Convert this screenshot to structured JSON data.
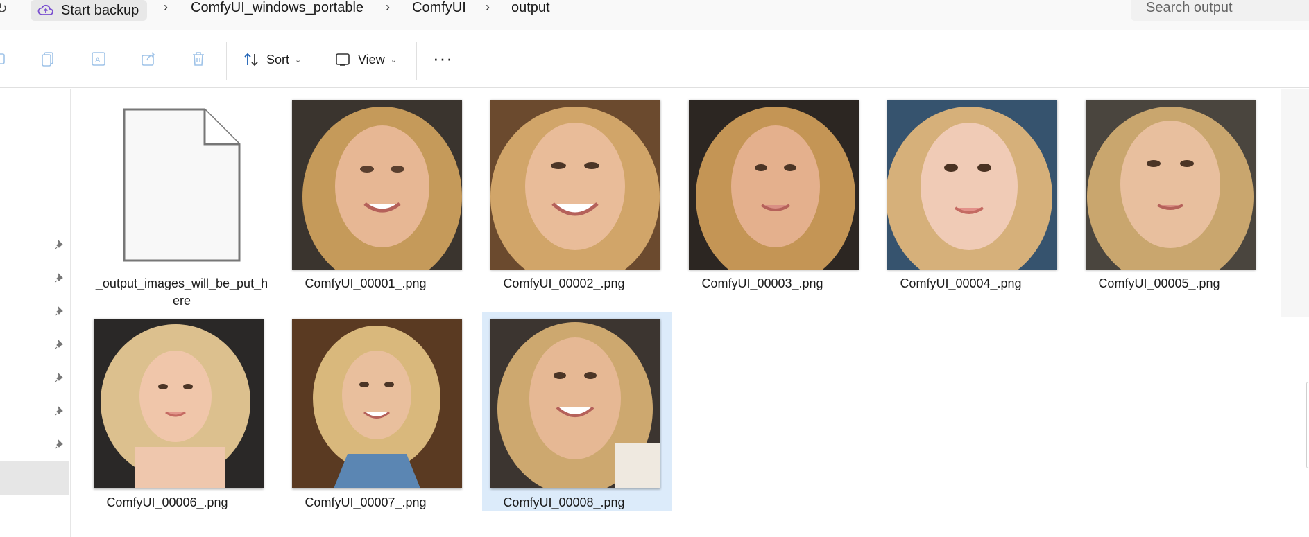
{
  "address_bar": {
    "breadcrumbs": [
      "Start backup",
      "ComfyUI_windows_portable",
      "ComfyUI",
      "output"
    ],
    "search_placeholder": "Search output"
  },
  "toolbar": {
    "sort_label": "Sort",
    "view_label": "View",
    "more_label": "···"
  },
  "files": [
    {
      "name": "_output_images_will_be_put_here",
      "type": "blank-file"
    },
    {
      "name": "ComfyUI_00001_.png",
      "type": "image"
    },
    {
      "name": "ComfyUI_00002_.png",
      "type": "image"
    },
    {
      "name": "ComfyUI_00003_.png",
      "type": "image"
    },
    {
      "name": "ComfyUI_00004_.png",
      "type": "image"
    },
    {
      "name": "ComfyUI_00005_.png",
      "type": "image"
    },
    {
      "name": "ComfyUI_00006_.png",
      "type": "image"
    },
    {
      "name": "ComfyUI_00007_.png",
      "type": "image"
    },
    {
      "name": "ComfyUI_00008_.png",
      "type": "image",
      "selected": true
    }
  ],
  "colors": {
    "selection": "#dcebfa",
    "accent": "#0067c0"
  },
  "icons": [
    "cloud-upload-icon",
    "copy-icon",
    "paste-icon",
    "rename-icon",
    "share-icon",
    "delete-icon",
    "sort-icon",
    "view-icon",
    "more-icon",
    "pin-icon",
    "blank-file-icon"
  ]
}
